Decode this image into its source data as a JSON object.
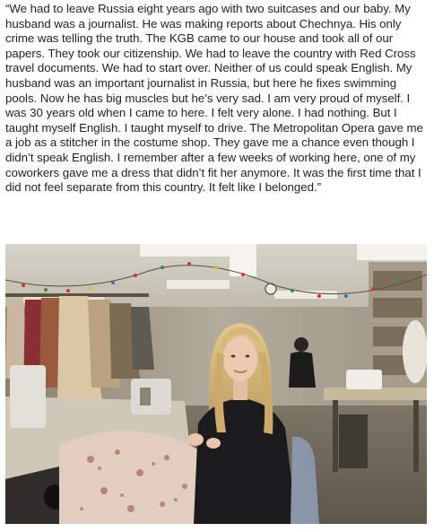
{
  "post": {
    "text": "“We had to leave Russia eight years ago with two suitcases and our baby. My husband was a journalist. He was making reports about Chechnya. His only crime was telling the truth. The KGB came to our house and took all of our papers. They took our citizenship. We had to leave the country with Red Cross travel documents. We had to start over. Neither of us could speak English. My husband was an important journalist in Russia, but here he fixes swimming pools. Now he has big muscles but he’s very sad. I am very proud of myself. I was 30 years old when I came to here. I felt very alone. I had nothing. But I taught myself English. I taught myself to drive. The Metropolitan Opera gave me a job as a stitcher in the costume shop. They gave me a chance even though I didn’t speak English. I remember after a few weeks of working here, one of my coworkers gave me a dress that didn’t fit her anymore. It was the first time that I did not feel separate from this country. It felt like I belonged.”"
  },
  "photo": {
    "colors": {
      "ceiling": "#e7e4dc",
      "wall": "#c9c3b4",
      "floor": "#8d8576",
      "hair": "#d8b875",
      "skin": "#e9c7ad",
      "clothing": "#1b1a1c",
      "fabric": "#e6cfc2"
    }
  }
}
